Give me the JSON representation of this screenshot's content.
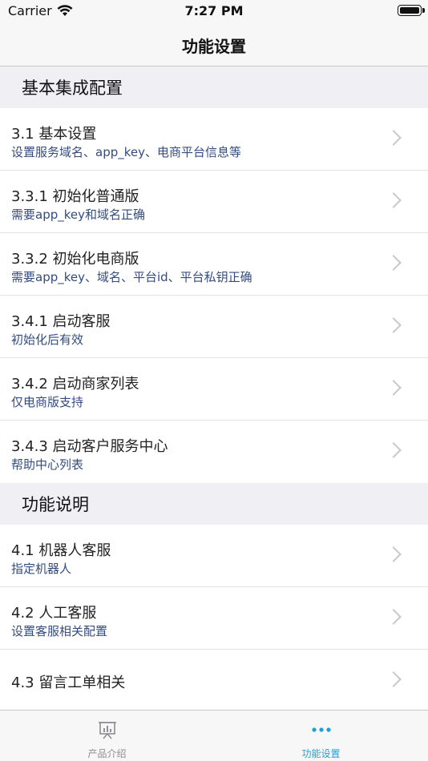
{
  "status_bar": {
    "carrier": "Carrier",
    "time": "7:27 PM"
  },
  "nav": {
    "title": "功能设置"
  },
  "sections": [
    {
      "header": "基本集成配置",
      "rows": [
        {
          "title": "3.1 基本设置",
          "subtitle": "设置服务域名、app_key、电商平台信息等"
        },
        {
          "title": "3.3.1 初始化普通版",
          "subtitle": "需要app_key和域名正确"
        },
        {
          "title": "3.3.2 初始化电商版",
          "subtitle": "需要app_key、域名、平台id、平台私钥正确"
        },
        {
          "title": "3.4.1 启动客服",
          "subtitle": "初始化后有效"
        },
        {
          "title": "3.4.2 启动商家列表",
          "subtitle": "仅电商版支持"
        },
        {
          "title": "3.4.3 启动客户服务中心",
          "subtitle": "帮助中心列表"
        }
      ]
    },
    {
      "header": "功能说明",
      "rows": [
        {
          "title": "4.1 机器人客服",
          "subtitle": "指定机器人"
        },
        {
          "title": "4.2 人工客服",
          "subtitle": "设置客服相关配置"
        },
        {
          "title": "4.3 留言工单相关",
          "subtitle": ""
        }
      ]
    }
  ],
  "tabbar": {
    "tabs": [
      {
        "label": "产品介绍",
        "icon": "presentation-chart-icon",
        "active": false
      },
      {
        "label": "功能设置",
        "icon": "more-dots-icon",
        "active": true
      }
    ],
    "active_color": "#1aa3d9",
    "inactive_color": "#8e8e93"
  }
}
